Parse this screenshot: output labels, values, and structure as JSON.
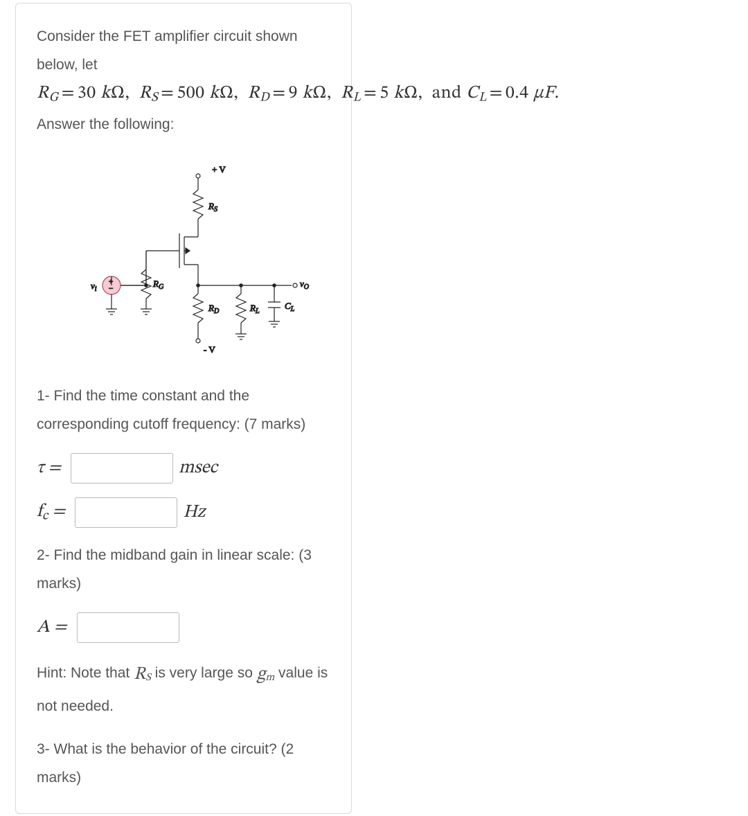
{
  "intro": {
    "line1": "Consider the FET amplifier circuit shown below, let",
    "param_line": "R_G = 30 kΩ,  R_S = 500 kΩ,  R_D = 9 kΩ,  R_L = 5 kΩ,  and C_L = 0.4 μF.",
    "followup": "Answer the following:"
  },
  "circuit_labels": {
    "vplus": "+ V",
    "vminus": "- V",
    "RS": "R_S",
    "RG": "R_G",
    "RD": "R_D",
    "RL": "R_L",
    "CL": "C_L",
    "vi": "v_i",
    "vo": "v_O"
  },
  "q1": {
    "prompt": "1- Find the time constant and the corresponding cutoff frequency: (7 marks)",
    "tau_label": "τ =",
    "tau_unit": "msec",
    "fc_label": "f_c =",
    "fc_unit": "Hz"
  },
  "q2": {
    "prompt": "2- Find the midband gain in linear scale: (3 marks)",
    "A_label": "A ="
  },
  "hint": {
    "pre": "Hint: Note that ",
    "RS": "R_S",
    "mid": " is very large so ",
    "gm": "g_m",
    "post": " value is not needed."
  },
  "q3": {
    "prompt": "3- What is the behavior of the circuit? (2 marks)"
  }
}
